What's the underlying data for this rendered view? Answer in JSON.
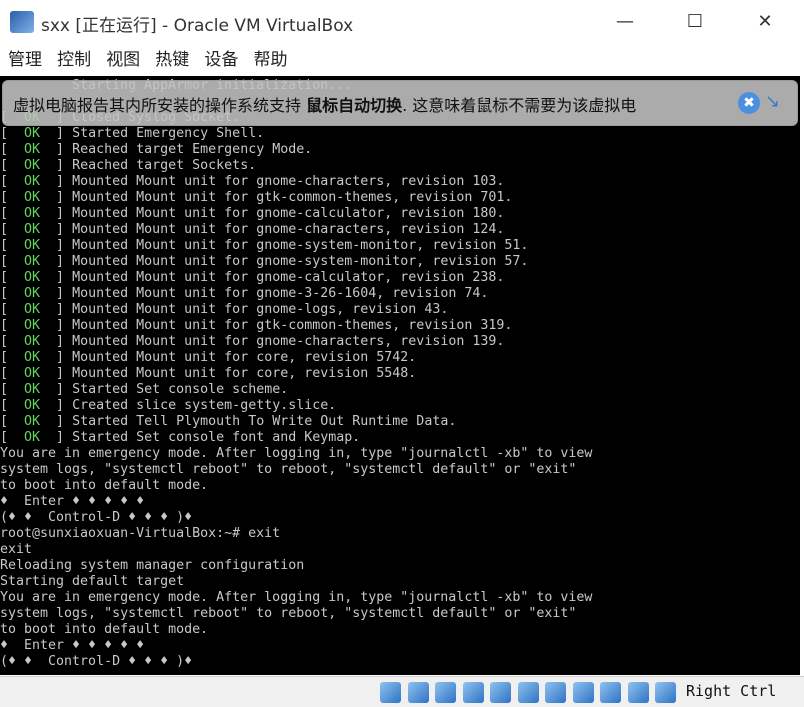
{
  "window": {
    "title": "sxx [正在运行] - Oracle VM VirtualBox",
    "minimize": "—",
    "maximize": "☐",
    "close": "✕"
  },
  "menu": [
    "管理",
    "控制",
    "视图",
    "热键",
    "设备",
    "帮助"
  ],
  "overlay": {
    "text_before": "虚拟电脑报告其内所安装的操作系统支持 ",
    "bold": "鼠标自动切换",
    "text_after": ". 这意味着鼠标不需要为该虚拟电",
    "close_icon": "✖",
    "mouse_icon": "↘"
  },
  "console": {
    "lines": [
      {
        "ok": false,
        "text": "         Starting AppArmor initialization..."
      },
      {
        "ok": false,
        "text": ""
      },
      {
        "ok": true,
        "text": "Closed Syslog Socket."
      },
      {
        "ok": true,
        "text": "Started Emergency Shell."
      },
      {
        "ok": true,
        "text": "Reached target Emergency Mode."
      },
      {
        "ok": true,
        "text": "Reached target Sockets."
      },
      {
        "ok": true,
        "text": "Mounted Mount unit for gnome-characters, revision 103."
      },
      {
        "ok": true,
        "text": "Mounted Mount unit for gtk-common-themes, revision 701."
      },
      {
        "ok": true,
        "text": "Mounted Mount unit for gnome-calculator, revision 180."
      },
      {
        "ok": true,
        "text": "Mounted Mount unit for gnome-characters, revision 124."
      },
      {
        "ok": true,
        "text": "Mounted Mount unit for gnome-system-monitor, revision 51."
      },
      {
        "ok": true,
        "text": "Mounted Mount unit for gnome-system-monitor, revision 57."
      },
      {
        "ok": true,
        "text": "Mounted Mount unit for gnome-calculator, revision 238."
      },
      {
        "ok": true,
        "text": "Mounted Mount unit for gnome-3-26-1604, revision 74."
      },
      {
        "ok": true,
        "text": "Mounted Mount unit for gnome-logs, revision 43."
      },
      {
        "ok": true,
        "text": "Mounted Mount unit for gtk-common-themes, revision 319."
      },
      {
        "ok": true,
        "text": "Mounted Mount unit for gnome-characters, revision 139."
      },
      {
        "ok": true,
        "text": "Mounted Mount unit for core, revision 5742."
      },
      {
        "ok": true,
        "text": "Mounted Mount unit for core, revision 5548."
      },
      {
        "ok": true,
        "text": "Started Set console scheme."
      },
      {
        "ok": true,
        "text": "Created slice system-getty.slice."
      },
      {
        "ok": true,
        "text": "Started Tell Plymouth To Write Out Runtime Data."
      },
      {
        "ok": true,
        "text": "Started Set console font and Keymap."
      },
      {
        "ok": false,
        "text": "You are in emergency mode. After logging in, type \"journalctl -xb\" to view"
      },
      {
        "ok": false,
        "text": "system logs, \"systemctl reboot\" to reboot, \"systemctl default\" or \"exit\""
      },
      {
        "ok": false,
        "text": "to boot into default mode."
      },
      {
        "ok": false,
        "text": "♦  Enter ♦ ♦ ♦ ♦ ♦"
      },
      {
        "ok": false,
        "text": "(♦ ♦  Control-D ♦ ♦ ♦ )♦"
      },
      {
        "ok": false,
        "text": "root@sunxiaoxuan-VirtualBox:~# exit"
      },
      {
        "ok": false,
        "text": "exit"
      },
      {
        "ok": false,
        "text": "Reloading system manager configuration"
      },
      {
        "ok": false,
        "text": "Starting default target"
      },
      {
        "ok": false,
        "text": "You are in emergency mode. After logging in, type \"journalctl -xb\" to view"
      },
      {
        "ok": false,
        "text": "system logs, \"systemctl reboot\" to reboot, \"systemctl default\" or \"exit\""
      },
      {
        "ok": false,
        "text": "to boot into default mode."
      },
      {
        "ok": false,
        "text": "♦  Enter ♦ ♦ ♦ ♦ ♦"
      },
      {
        "ok": false,
        "text": "(♦ ♦  Control-D ♦ ♦ ♦ )♦"
      }
    ],
    "ok_prefix_open": "[  ",
    "ok_label": "OK",
    "ok_prefix_close": "  ] "
  },
  "statusbar": {
    "icons": [
      "hard-disk-icon",
      "optical-disk-icon",
      "audio-icon",
      "network-icon",
      "usb-icon",
      "shared-folders-icon",
      "display-icon",
      "video-capture-icon",
      "cpu-icon",
      "mouse-integration-icon",
      "keyboard-capture-icon"
    ],
    "host_key": "Right Ctrl"
  }
}
